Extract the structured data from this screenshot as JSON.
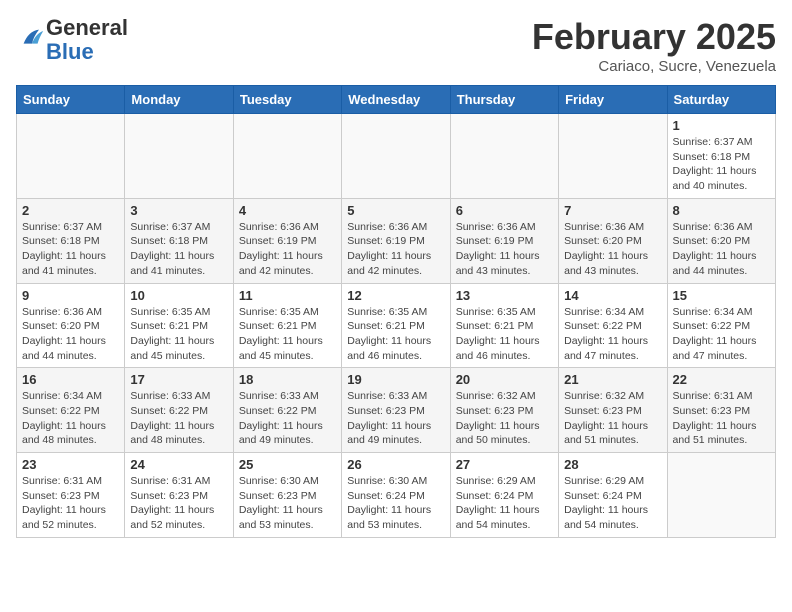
{
  "header": {
    "logo_general": "General",
    "logo_blue": "Blue",
    "month_year": "February 2025",
    "location": "Cariaco, Sucre, Venezuela"
  },
  "weekdays": [
    "Sunday",
    "Monday",
    "Tuesday",
    "Wednesday",
    "Thursday",
    "Friday",
    "Saturday"
  ],
  "weeks": [
    [
      {
        "day": "",
        "info": ""
      },
      {
        "day": "",
        "info": ""
      },
      {
        "day": "",
        "info": ""
      },
      {
        "day": "",
        "info": ""
      },
      {
        "day": "",
        "info": ""
      },
      {
        "day": "",
        "info": ""
      },
      {
        "day": "1",
        "info": "Sunrise: 6:37 AM\nSunset: 6:18 PM\nDaylight: 11 hours\nand 40 minutes."
      }
    ],
    [
      {
        "day": "2",
        "info": "Sunrise: 6:37 AM\nSunset: 6:18 PM\nDaylight: 11 hours\nand 41 minutes."
      },
      {
        "day": "3",
        "info": "Sunrise: 6:37 AM\nSunset: 6:18 PM\nDaylight: 11 hours\nand 41 minutes."
      },
      {
        "day": "4",
        "info": "Sunrise: 6:36 AM\nSunset: 6:19 PM\nDaylight: 11 hours\nand 42 minutes."
      },
      {
        "day": "5",
        "info": "Sunrise: 6:36 AM\nSunset: 6:19 PM\nDaylight: 11 hours\nand 42 minutes."
      },
      {
        "day": "6",
        "info": "Sunrise: 6:36 AM\nSunset: 6:19 PM\nDaylight: 11 hours\nand 43 minutes."
      },
      {
        "day": "7",
        "info": "Sunrise: 6:36 AM\nSunset: 6:20 PM\nDaylight: 11 hours\nand 43 minutes."
      },
      {
        "day": "8",
        "info": "Sunrise: 6:36 AM\nSunset: 6:20 PM\nDaylight: 11 hours\nand 44 minutes."
      }
    ],
    [
      {
        "day": "9",
        "info": "Sunrise: 6:36 AM\nSunset: 6:20 PM\nDaylight: 11 hours\nand 44 minutes."
      },
      {
        "day": "10",
        "info": "Sunrise: 6:35 AM\nSunset: 6:21 PM\nDaylight: 11 hours\nand 45 minutes."
      },
      {
        "day": "11",
        "info": "Sunrise: 6:35 AM\nSunset: 6:21 PM\nDaylight: 11 hours\nand 45 minutes."
      },
      {
        "day": "12",
        "info": "Sunrise: 6:35 AM\nSunset: 6:21 PM\nDaylight: 11 hours\nand 46 minutes."
      },
      {
        "day": "13",
        "info": "Sunrise: 6:35 AM\nSunset: 6:21 PM\nDaylight: 11 hours\nand 46 minutes."
      },
      {
        "day": "14",
        "info": "Sunrise: 6:34 AM\nSunset: 6:22 PM\nDaylight: 11 hours\nand 47 minutes."
      },
      {
        "day": "15",
        "info": "Sunrise: 6:34 AM\nSunset: 6:22 PM\nDaylight: 11 hours\nand 47 minutes."
      }
    ],
    [
      {
        "day": "16",
        "info": "Sunrise: 6:34 AM\nSunset: 6:22 PM\nDaylight: 11 hours\nand 48 minutes."
      },
      {
        "day": "17",
        "info": "Sunrise: 6:33 AM\nSunset: 6:22 PM\nDaylight: 11 hours\nand 48 minutes."
      },
      {
        "day": "18",
        "info": "Sunrise: 6:33 AM\nSunset: 6:22 PM\nDaylight: 11 hours\nand 49 minutes."
      },
      {
        "day": "19",
        "info": "Sunrise: 6:33 AM\nSunset: 6:23 PM\nDaylight: 11 hours\nand 49 minutes."
      },
      {
        "day": "20",
        "info": "Sunrise: 6:32 AM\nSunset: 6:23 PM\nDaylight: 11 hours\nand 50 minutes."
      },
      {
        "day": "21",
        "info": "Sunrise: 6:32 AM\nSunset: 6:23 PM\nDaylight: 11 hours\nand 51 minutes."
      },
      {
        "day": "22",
        "info": "Sunrise: 6:31 AM\nSunset: 6:23 PM\nDaylight: 11 hours\nand 51 minutes."
      }
    ],
    [
      {
        "day": "23",
        "info": "Sunrise: 6:31 AM\nSunset: 6:23 PM\nDaylight: 11 hours\nand 52 minutes."
      },
      {
        "day": "24",
        "info": "Sunrise: 6:31 AM\nSunset: 6:23 PM\nDaylight: 11 hours\nand 52 minutes."
      },
      {
        "day": "25",
        "info": "Sunrise: 6:30 AM\nSunset: 6:23 PM\nDaylight: 11 hours\nand 53 minutes."
      },
      {
        "day": "26",
        "info": "Sunrise: 6:30 AM\nSunset: 6:24 PM\nDaylight: 11 hours\nand 53 minutes."
      },
      {
        "day": "27",
        "info": "Sunrise: 6:29 AM\nSunset: 6:24 PM\nDaylight: 11 hours\nand 54 minutes."
      },
      {
        "day": "28",
        "info": "Sunrise: 6:29 AM\nSunset: 6:24 PM\nDaylight: 11 hours\nand 54 minutes."
      },
      {
        "day": "",
        "info": ""
      }
    ]
  ]
}
